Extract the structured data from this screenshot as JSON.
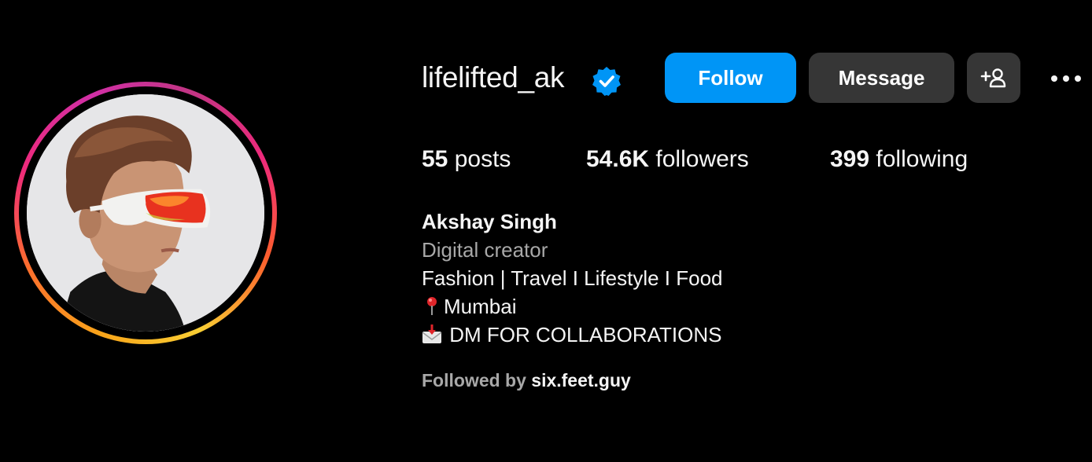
{
  "profile": {
    "username": "lifelifted_ak",
    "verified": true,
    "avatar_icon": "profile-photo-man-with-red-sunglasses"
  },
  "actions": {
    "follow_label": "Follow",
    "message_label": "Message",
    "suggest_icon": "add-person-icon",
    "more_icon": "ellipsis-icon"
  },
  "stats": {
    "posts_count": "55",
    "posts_label": "posts",
    "followers_count": "54.6K",
    "followers_label": "followers",
    "following_count": "399",
    "following_label": "following"
  },
  "bio": {
    "full_name": "Akshay Singh",
    "category": "Digital creator",
    "line1": "Fashion | Travel I Lifestyle I Food",
    "location_icon": "round-pushpin-emoji",
    "location": "Mumbai",
    "mail_icon": "envelope-with-arrow-emoji",
    "dm_text": "DM FOR COLLABORATIONS"
  },
  "followed_by": {
    "prefix": "Followed by",
    "user": "six.feet.guy"
  },
  "colors": {
    "background": "#000000",
    "follow_button": "#0095f6",
    "secondary_button": "#363636",
    "verified_badge": "#0095f6",
    "muted_text": "#a8a8a8"
  }
}
